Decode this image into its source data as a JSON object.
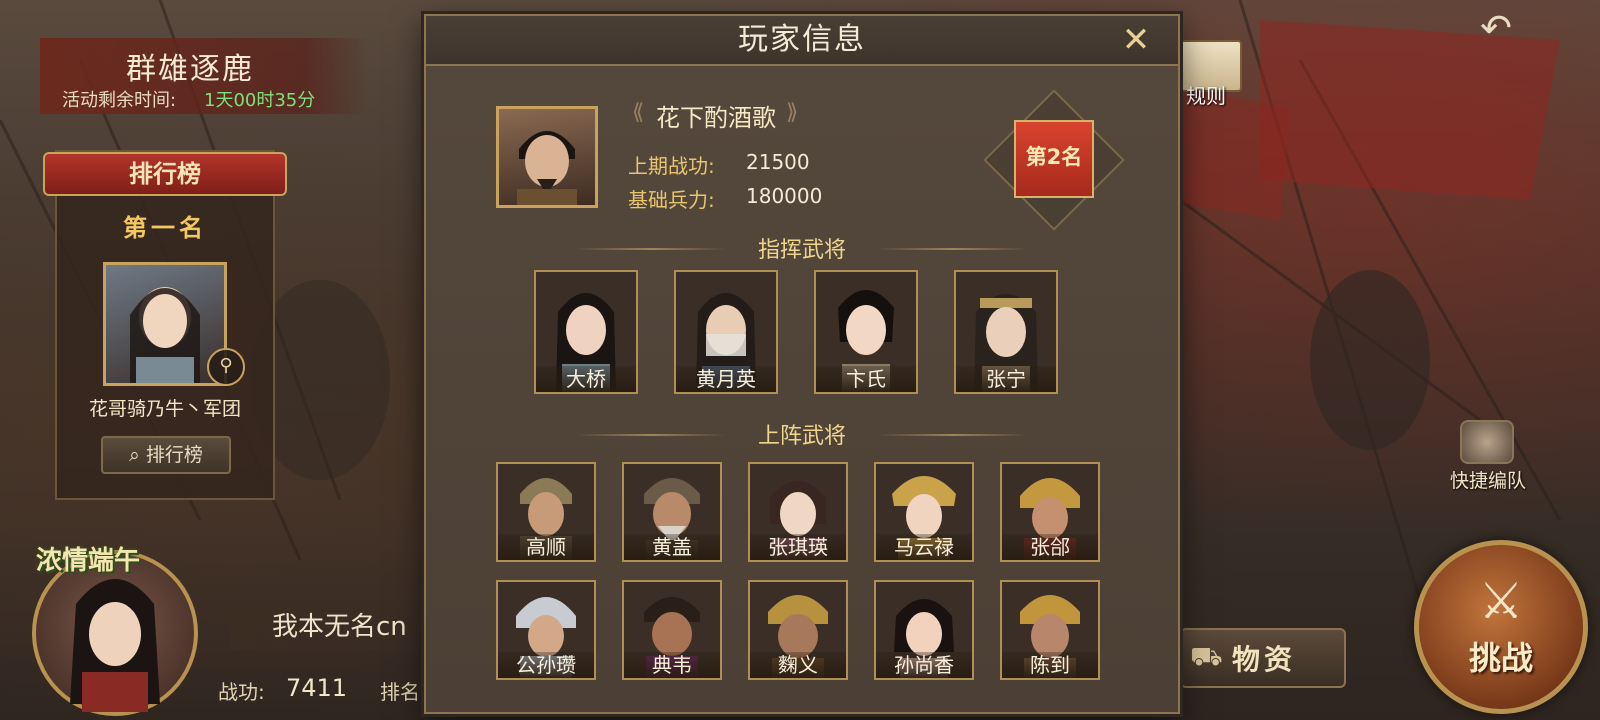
{
  "event": {
    "title": "群雄逐鹿",
    "timer_label": "活动剩余时间:",
    "timer_value": "1天00时35分"
  },
  "ranking_panel": {
    "title": "排行榜",
    "first_place_label": "第一名",
    "first_place_name": "花哥骑乃牛丶军团",
    "button_label": "排行榜"
  },
  "festival": {
    "title": "浓情端午"
  },
  "player": {
    "name": "我本无名cn",
    "merit_label": "战功:",
    "merit_value": "7411",
    "rank_label": "排名"
  },
  "right_controls": {
    "rules_label": "规则",
    "quick_team_label": "快捷编队",
    "supplies_label": "物资",
    "challenge_label": "挑战"
  },
  "dialog": {
    "title": "玩家信息",
    "player_name": "花下酌酒歌",
    "last_merit_label": "上期战功:",
    "last_merit_value": "21500",
    "base_troops_label": "基础兵力:",
    "base_troops_value": "180000",
    "rank_badge": "第2名",
    "commanders_title": "指挥武将",
    "commanders": [
      "大桥",
      "黄月英",
      "卞氏",
      "张宁"
    ],
    "deployed_title": "上阵武将",
    "deployed_row1": [
      "高顺",
      "黄盖",
      "张琪瑛",
      "马云禄",
      "张郃"
    ],
    "deployed_row2": [
      "公孙瓒",
      "典韦",
      "麴义",
      "孙尚香",
      "陈到"
    ]
  },
  "colors": {
    "accent_gold": "#c9a35c",
    "timer_green": "#7fe07a",
    "rank_red": "#d9432f",
    "dialog_bg": "#4c4036"
  }
}
